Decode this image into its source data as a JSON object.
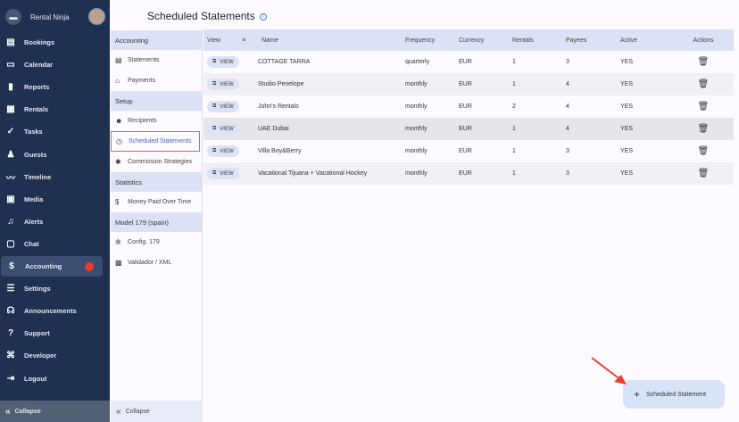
{
  "app": {
    "name": "Rental Ninja"
  },
  "nav": [
    {
      "label": "Bookings",
      "icon": "▤"
    },
    {
      "label": "Calendar",
      "icon": "▭"
    },
    {
      "label": "Reports",
      "icon": "▮"
    },
    {
      "label": "Rentals",
      "icon": "▦"
    },
    {
      "label": "Tasks",
      "icon": "✓"
    },
    {
      "label": "Guests",
      "icon": "♟"
    },
    {
      "label": "Timeline",
      "icon": "〰"
    },
    {
      "label": "Media",
      "icon": "▣"
    },
    {
      "label": "Alerts",
      "icon": "♫"
    },
    {
      "label": "Chat",
      "icon": "▢"
    },
    {
      "label": "Accounting",
      "icon": "$"
    },
    {
      "label": "Settings",
      "icon": "☰"
    },
    {
      "label": "Announcements",
      "icon": "☊"
    },
    {
      "label": "Support",
      "icon": "?"
    },
    {
      "label": "Developer",
      "icon": "⌘"
    },
    {
      "label": "Logout",
      "icon": "⇥"
    }
  ],
  "collapse": "Collapse",
  "submenu": [
    {
      "type": "h",
      "label": "Accounting"
    },
    {
      "type": "i",
      "label": "Statements",
      "icon": "▤"
    },
    {
      "type": "i",
      "label": "Payments",
      "icon": "⌂"
    },
    {
      "type": "h",
      "label": "Setup"
    },
    {
      "type": "i",
      "label": "Recipients",
      "icon": "☻"
    },
    {
      "type": "i",
      "label": "Scheduled Statements",
      "icon": "◷",
      "selected": true
    },
    {
      "type": "i",
      "label": "Commission Strategies",
      "icon": "✱"
    },
    {
      "type": "h",
      "label": "Statistics"
    },
    {
      "type": "i",
      "label": "Money Paid Over Time",
      "icon": "$"
    },
    {
      "type": "h",
      "label": "Model 179 (spain)"
    },
    {
      "type": "i",
      "label": "Config. 179",
      "icon": "✲"
    },
    {
      "type": "i",
      "label": "Validador / XML",
      "icon": "▩"
    }
  ],
  "page": {
    "title": "Scheduled Statements"
  },
  "table": {
    "headers": [
      "View",
      "Name",
      "Frequency",
      "Currency",
      "Rentals",
      "Payees",
      "Active",
      "Actions"
    ],
    "view_label": "VIEW",
    "rows": [
      [
        "COTTAGE TARRA",
        "quarterly",
        "EUR",
        "1",
        "3",
        "YES"
      ],
      [
        "Studio Penelope",
        "monthly",
        "EUR",
        "1",
        "4",
        "YES"
      ],
      [
        "John's Rentals",
        "monthly",
        "EUR",
        "2",
        "4",
        "YES"
      ],
      [
        "UAE Dubai",
        "monthly",
        "EUR",
        "1",
        "4",
        "YES"
      ],
      [
        "Villa Boy&Berry",
        "monthly",
        "EUR",
        "1",
        "3",
        "YES"
      ],
      [
        "Vacational Tijuana + Vacational Hockey",
        "monthly",
        "EUR",
        "1",
        "3",
        "YES"
      ]
    ]
  },
  "fab": {
    "label": "Scheduled Statement"
  }
}
